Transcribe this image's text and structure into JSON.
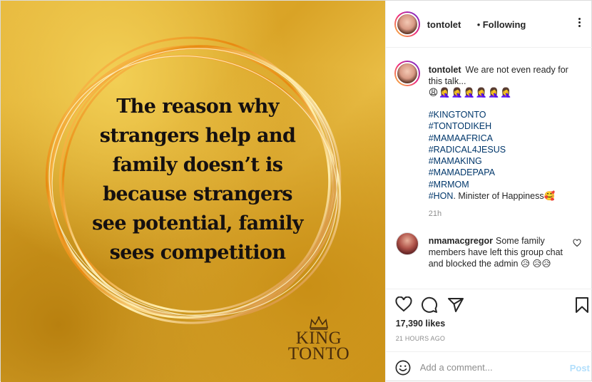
{
  "post": {
    "image": {
      "quote_lines": [
        "The reason why",
        "strangers help and",
        "family doesn’t is",
        "because strangers",
        "see potential, family",
        "sees competition"
      ],
      "brand_line1": "KING",
      "brand_line2": "TONTO",
      "background_color": "#dcaa2f",
      "ring_color": "#f2a11a"
    },
    "header": {
      "username": "tontolet",
      "dot": "•",
      "follow_status": "Following"
    },
    "caption": {
      "username": "tontolet",
      "text": "We are not even ready for this talk...",
      "emojis": "😩🤦‍♀️🤦‍♀️🤦‍♀️🤦‍♀️🤦‍♀️🤦‍♀️",
      "hashtags": [
        "#KINGTONTO",
        "#TONTODIKEH",
        "#MAMAAFRICA",
        "#RADICAL4JESUS",
        "#MAMAKING",
        "#MAMADEPAPA",
        "#MRMOM"
      ],
      "last_tag": "#HON",
      "last_tag_text": ". Minister of Happiness🥰",
      "time": "21h"
    },
    "comment": {
      "username": "nmamacgregor",
      "text": "Some family members have left this group chat and blocked the admin 😥 😥😥"
    },
    "likes": "17,390 likes",
    "timestamp": "21 HOURS AGO",
    "add_comment": {
      "placeholder": "Add a comment...",
      "post_label": "Post"
    }
  }
}
